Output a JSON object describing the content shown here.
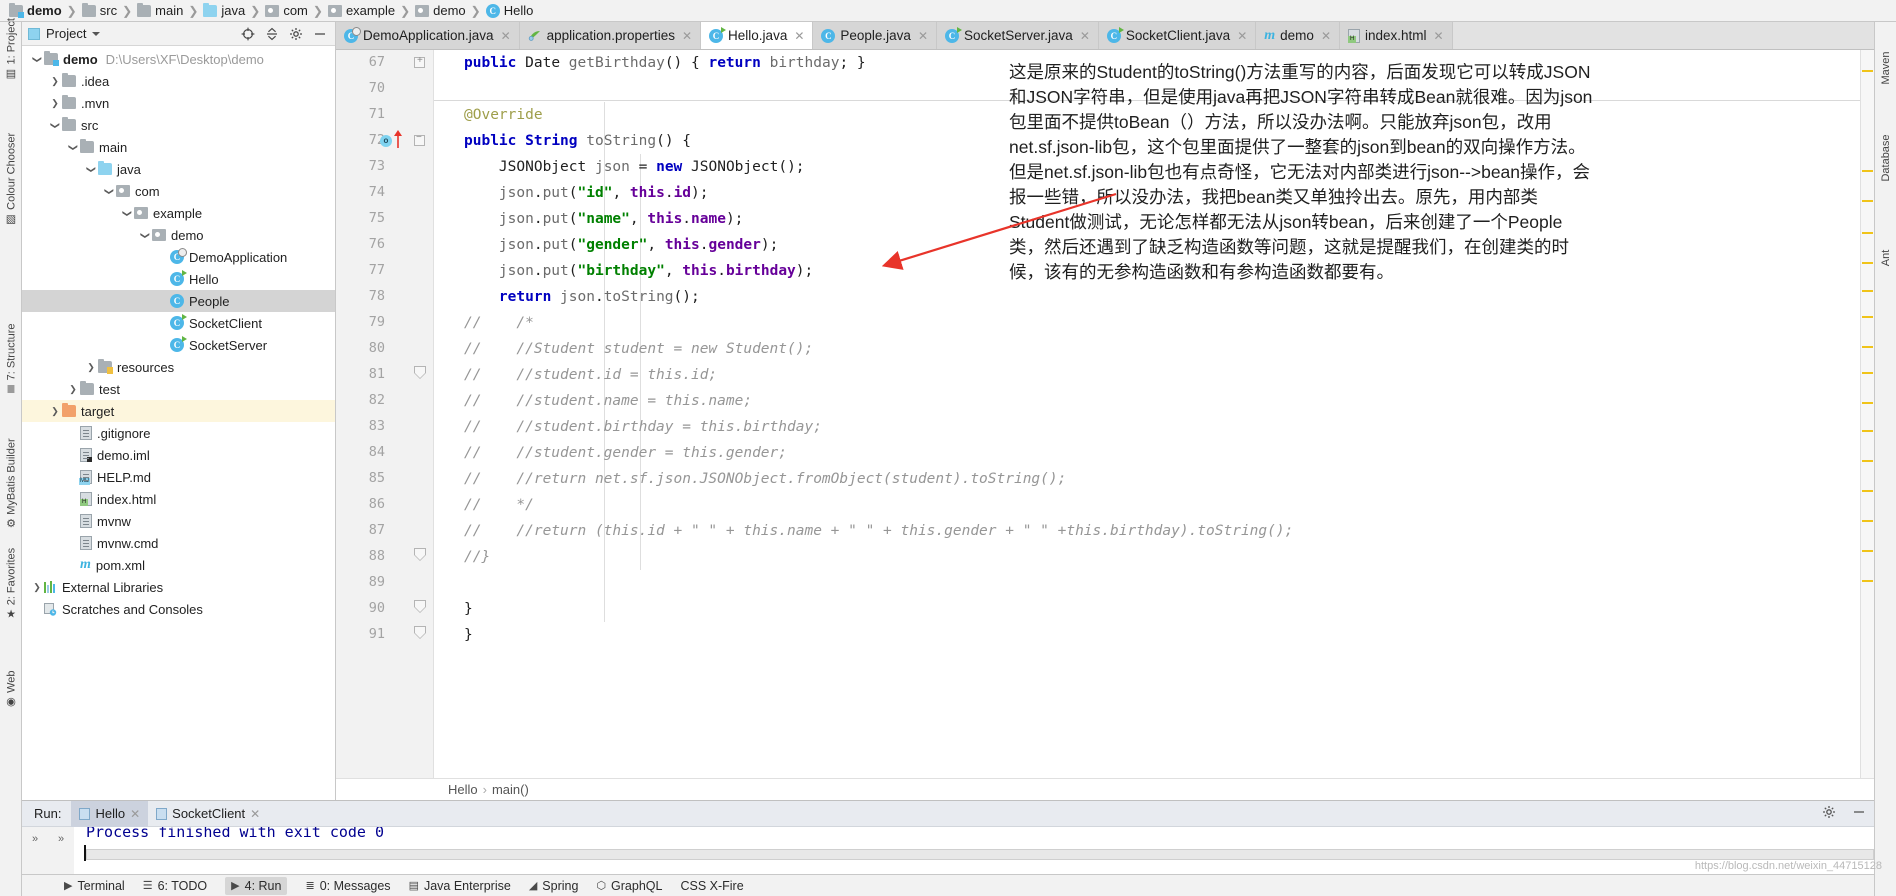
{
  "breadcrumb": [
    {
      "label": "demo",
      "icon": "project-folder-icon",
      "bold": true
    },
    {
      "label": "src",
      "icon": "folder-icon",
      "bold": false
    },
    {
      "label": "main",
      "icon": "folder-icon",
      "bold": false
    },
    {
      "label": "java",
      "icon": "source-folder-icon",
      "bold": false
    },
    {
      "label": "com",
      "icon": "package-icon",
      "bold": false
    },
    {
      "label": "example",
      "icon": "package-icon",
      "bold": false
    },
    {
      "label": "demo",
      "icon": "package-icon",
      "bold": false
    },
    {
      "label": "Hello",
      "icon": "java-class-icon",
      "bold": false
    }
  ],
  "left_rail": [
    {
      "label": "1: Project",
      "icon": "project-tool-icon"
    },
    {
      "label": "Colour Chooser",
      "icon": "palette-icon"
    },
    {
      "label": "7: Structure",
      "icon": "structure-icon"
    },
    {
      "label": "MyBatis Builder",
      "icon": "mybatis-icon"
    },
    {
      "label": "2: Favorites",
      "icon": "star-icon"
    },
    {
      "label": "Web",
      "icon": "web-icon"
    }
  ],
  "project_panel": {
    "title": "Project",
    "buttons": [
      "locate-icon",
      "collapse-all-icon",
      "settings-icon",
      "hide-icon"
    ],
    "tree": [
      {
        "label": "demo",
        "path": "D:\\Users\\XF\\Desktop\\demo",
        "icon": "project-folder-icon",
        "indent": 0,
        "state": "expanded",
        "bold": true
      },
      {
        "label": ".idea",
        "icon": "folder-icon",
        "indent": 1,
        "state": "collapsed"
      },
      {
        "label": ".mvn",
        "icon": "folder-icon",
        "indent": 1,
        "state": "collapsed"
      },
      {
        "label": "src",
        "icon": "folder-icon",
        "indent": 1,
        "state": "expanded"
      },
      {
        "label": "main",
        "icon": "folder-icon",
        "indent": 2,
        "state": "expanded"
      },
      {
        "label": "java",
        "icon": "source-folder-icon",
        "indent": 3,
        "state": "expanded"
      },
      {
        "label": "com",
        "icon": "package-icon",
        "indent": 4,
        "state": "expanded"
      },
      {
        "label": "example",
        "icon": "package-icon",
        "indent": 5,
        "state": "expanded"
      },
      {
        "label": "demo",
        "icon": "package-icon",
        "indent": 6,
        "state": "expanded"
      },
      {
        "label": "DemoApplication",
        "icon": "spring-class-icon",
        "indent": 7,
        "state": "leaf"
      },
      {
        "label": "Hello",
        "icon": "runnable-class-icon",
        "indent": 7,
        "state": "leaf"
      },
      {
        "label": "People",
        "icon": "java-class-icon",
        "indent": 7,
        "state": "leaf",
        "selected": true
      },
      {
        "label": "SocketClient",
        "icon": "runnable-class-icon",
        "indent": 7,
        "state": "leaf"
      },
      {
        "label": "SocketServer",
        "icon": "runnable-class-icon",
        "indent": 7,
        "state": "leaf"
      },
      {
        "label": "resources",
        "icon": "resource-folder-icon",
        "indent": 3,
        "state": "collapsed"
      },
      {
        "label": "test",
        "icon": "folder-icon",
        "indent": 2,
        "state": "collapsed"
      },
      {
        "label": "target",
        "icon": "target-folder-icon",
        "indent": 1,
        "state": "collapsed",
        "highlighted": true
      },
      {
        "label": ".gitignore",
        "icon": "text-file-icon",
        "indent": 2,
        "state": "leaf"
      },
      {
        "label": "demo.iml",
        "icon": "iml-file-icon",
        "indent": 2,
        "state": "leaf"
      },
      {
        "label": "HELP.md",
        "icon": "markdown-file-icon",
        "indent": 2,
        "state": "leaf"
      },
      {
        "label": "index.html",
        "icon": "html-file-icon",
        "indent": 2,
        "state": "leaf"
      },
      {
        "label": "mvnw",
        "icon": "text-file-icon",
        "indent": 2,
        "state": "leaf"
      },
      {
        "label": "mvnw.cmd",
        "icon": "text-file-icon",
        "indent": 2,
        "state": "leaf"
      },
      {
        "label": "pom.xml",
        "icon": "maven-file-icon",
        "indent": 2,
        "state": "leaf"
      },
      {
        "label": "External Libraries",
        "icon": "libraries-icon",
        "indent": 0,
        "state": "collapsed"
      },
      {
        "label": "Scratches and Consoles",
        "icon": "scratches-icon",
        "indent": 0,
        "state": "leaf"
      }
    ]
  },
  "editor_tabs": [
    {
      "label": "DemoApplication.java",
      "icon": "spring-class-icon",
      "active": false
    },
    {
      "label": "application.properties",
      "icon": "properties-file-icon",
      "active": false
    },
    {
      "label": "Hello.java",
      "icon": "runnable-class-icon",
      "active": true
    },
    {
      "label": "People.java",
      "icon": "java-class-icon",
      "active": false
    },
    {
      "label": "SocketServer.java",
      "icon": "runnable-class-icon",
      "active": false
    },
    {
      "label": "SocketClient.java",
      "icon": "runnable-class-icon",
      "active": false
    },
    {
      "label": "demo",
      "icon": "maven-file-icon",
      "active": false
    },
    {
      "label": "index.html",
      "icon": "html-file-icon",
      "active": false
    }
  ],
  "code": {
    "line_numbers": [
      "67",
      "70",
      "71",
      "72",
      "73",
      "74",
      "75",
      "76",
      "77",
      "78",
      "79",
      "80",
      "81",
      "82",
      "83",
      "84",
      "85",
      "86",
      "87",
      "88",
      "89",
      "90",
      "91"
    ],
    "lines": [
      "public Date getBirthday() { return birthday; }",
      "",
      "@Override",
      "public String toString() {",
      "    JSONObject json = new JSONObject();",
      "    json.put(\"id\", this.id);",
      "    json.put(\"name\", this.name);",
      "    json.put(\"gender\", this.gender);",
      "    json.put(\"birthday\", this.birthday);",
      "    return json.toString();",
      "//    /*",
      "//    //Student student = new Student();",
      "//    //student.id = this.id;",
      "//    //student.name = this.name;",
      "//    //student.birthday = this.birthday;",
      "//    //student.gender = this.gender;",
      "//    //return net.sf.json.JSONObject.fromObject(student).toString();",
      "//    */",
      "//    //return (this.id + \" \" + this.name + \" \" + this.gender + \" \" +this.birthday).toString();",
      "//}",
      "",
      "}",
      "}"
    ],
    "breakpoint_line": "72"
  },
  "annotation": {
    "text": "这是原来的Student的toString()方法重写的内容，后面发现它可以转成JSON和JSON字符串，但是使用java再把JSON字符串转成Bean就很难。因为json包里面不提供toBean（）方法，所以没办法啊。只能放弃json包，改用net.sf.json-lib包，这个包里面提供了一整套的json到bean的双向操作方法。\n但是net.sf.json-lib包也有点奇怪，它无法对内部类进行json-->bean操作，会报一些错，所以没办法，我把bean类又单独拎出去。原先，用内部类Student做测试，无论怎样都无法从json转bean，后来创建了一个People类，然后还遇到了缺乏构造函数等问题，这就是提醒我们，在创建类的时候，该有的无参构造函数和有参构造函数都要有。",
    "arrow_color": "#e8342a"
  },
  "editor_breadcrumb": {
    "class": "Hello",
    "method": "main()",
    "separator": "›"
  },
  "run_panel": {
    "label": "Run:",
    "tabs": [
      {
        "label": "Hello",
        "active": true
      },
      {
        "label": "SocketClient",
        "active": false
      }
    ],
    "console_output": "Process finished with exit code 0"
  },
  "status_bar": [
    {
      "label": "Terminal",
      "icon": "terminal-icon"
    },
    {
      "label": "6: TODO",
      "icon": "todo-icon"
    },
    {
      "label": "4: Run",
      "icon": "run-icon",
      "active": true
    },
    {
      "label": "0: Messages",
      "icon": "messages-icon"
    },
    {
      "label": "Java Enterprise",
      "icon": "java-enterprise-icon"
    },
    {
      "label": "Spring",
      "icon": "spring-icon"
    },
    {
      "label": "GraphQL",
      "icon": "graphql-icon"
    },
    {
      "label": "CSS X-Fire",
      "icon": "cssxfire-icon"
    }
  ],
  "right_rail": [
    {
      "label": "Maven",
      "icon": "maven-icon"
    },
    {
      "label": "Database",
      "icon": "database-icon"
    },
    {
      "label": "Ant",
      "icon": "ant-icon"
    }
  ],
  "watermark": "https://blog.csdn.net/weixin_44715128",
  "colors": {
    "accent": "#4db7e8",
    "keyword": "#0000c0",
    "string": "#008000",
    "field": "#660099",
    "comment": "#969696",
    "annotation_red": "#e8342a",
    "selection": "#d4d4d4",
    "highlight": "#fdf6dd"
  }
}
